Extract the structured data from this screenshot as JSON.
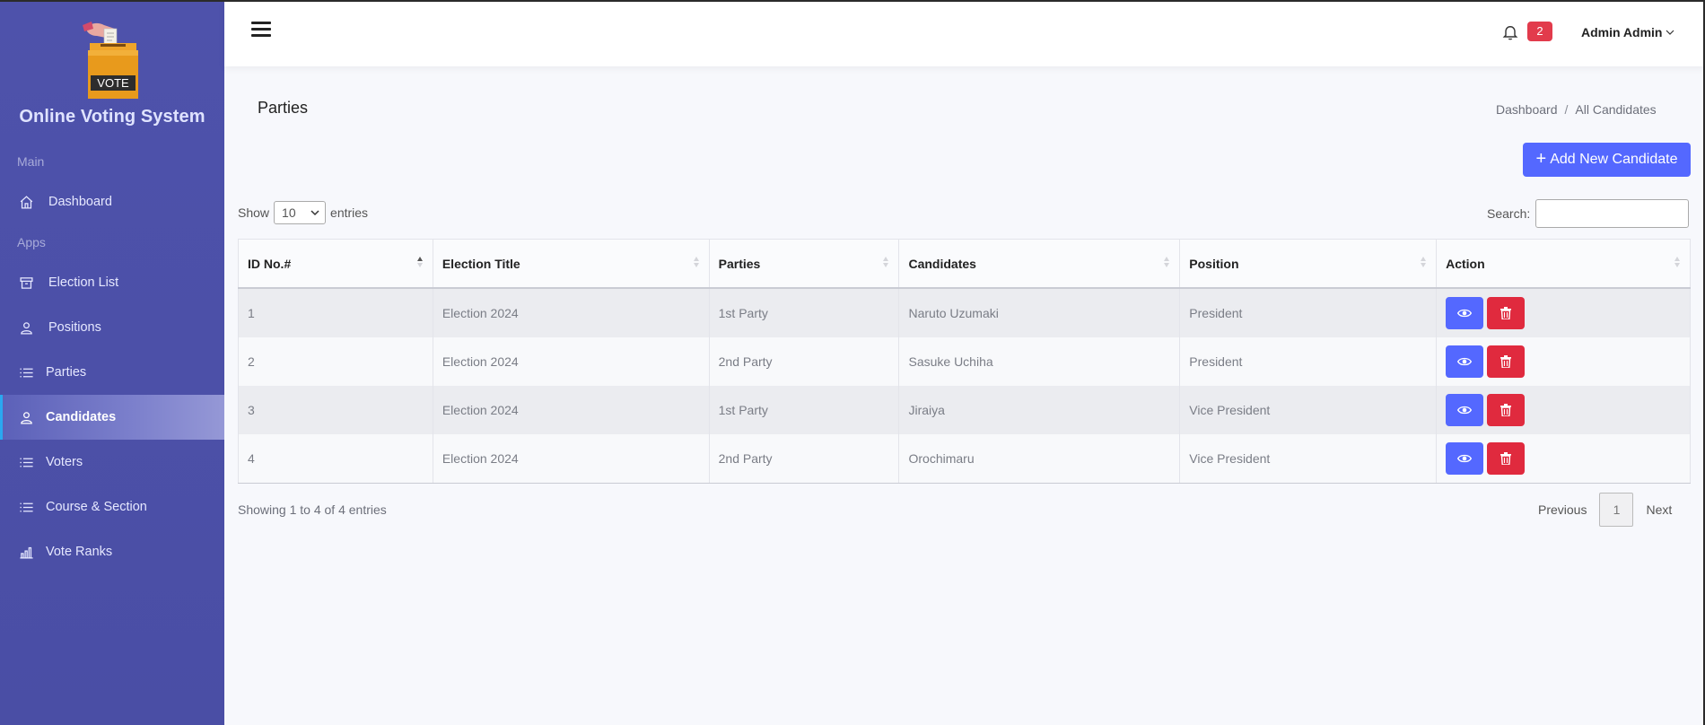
{
  "brand": {
    "name": "Online Voting System",
    "logo_text": "VOTE"
  },
  "sidebar": {
    "section_main": "Main",
    "section_apps": "Apps",
    "items": [
      {
        "label": "Dashboard",
        "icon": "home-icon"
      },
      {
        "label": "Election List",
        "icon": "archive-icon"
      },
      {
        "label": "Positions",
        "icon": "user-icon"
      },
      {
        "label": "Parties",
        "icon": "list-icon"
      },
      {
        "label": "Candidates",
        "icon": "user-icon",
        "active": true
      },
      {
        "label": "Voters",
        "icon": "list-icon"
      },
      {
        "label": "Course & Section",
        "icon": "list-icon"
      },
      {
        "label": "Vote Ranks",
        "icon": "bar-chart-icon"
      }
    ]
  },
  "header": {
    "notification_count": "2",
    "user_name": "Admin Admin"
  },
  "page": {
    "title": "Parties",
    "breadcrumb": {
      "home": "Dashboard",
      "separator": "/",
      "current": "All Candidates"
    },
    "add_button": "Add New Candidate"
  },
  "table_controls": {
    "show_label": "Show",
    "entries_value": "10",
    "entries_label": "entries",
    "search_label": "Search:"
  },
  "table": {
    "columns": [
      "ID No.#",
      "Election Title",
      "Parties",
      "Candidates",
      "Position",
      "Action"
    ],
    "rows": [
      {
        "id": "1",
        "election": "Election 2024",
        "party": "1st Party",
        "candidate": "Naruto Uzumaki",
        "position": "President"
      },
      {
        "id": "2",
        "election": "Election 2024",
        "party": "2nd Party",
        "candidate": "Sasuke Uchiha",
        "position": "President"
      },
      {
        "id": "3",
        "election": "Election 2024",
        "party": "1st Party",
        "candidate": "Jiraiya",
        "position": "Vice President"
      },
      {
        "id": "4",
        "election": "Election 2024",
        "party": "2nd Party",
        "candidate": "Orochimaru",
        "position": "Vice President"
      }
    ]
  },
  "footer": {
    "info": "Showing 1 to 4 of 4 entries",
    "previous": "Previous",
    "current_page": "1",
    "next": "Next"
  },
  "colors": {
    "sidebar": "#4b4fa6",
    "primary": "#5468ff",
    "danger": "#e02a3e",
    "badge": "#e23b4c"
  }
}
